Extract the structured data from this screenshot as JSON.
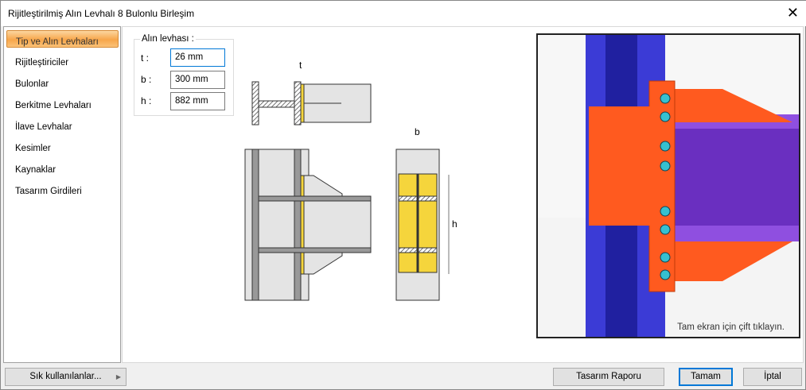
{
  "window": {
    "title": "Rijitleştirilmiş Alın Levhalı 8 Bulonlu Birleşim",
    "close_icon": "close-icon"
  },
  "sidebar": {
    "items": [
      {
        "label": "Tip ve Alın Levhaları",
        "active": true
      },
      {
        "label": "Rijitleştiriciler"
      },
      {
        "label": "Bulonlar"
      },
      {
        "label": "Berkitme Levhaları"
      },
      {
        "label": "İlave Levhalar"
      },
      {
        "label": "Kesimler"
      },
      {
        "label": "Kaynaklar"
      },
      {
        "label": "Tasarım Girdileri"
      }
    ]
  },
  "end_plate": {
    "title": "Alın levhası :",
    "fields": [
      {
        "label": "t :",
        "value": "26 mm"
      },
      {
        "label": "b :",
        "value": "300 mm"
      },
      {
        "label": "h :",
        "value": "882 mm"
      }
    ]
  },
  "drawing": {
    "t": "t",
    "b": "b",
    "h": "h"
  },
  "view3d": {
    "hint": "Tam ekran için çift tıklayın."
  },
  "footer": {
    "favorites": "Sık kullanılanlar...",
    "report": "Tasarım Raporu",
    "ok": "Tamam",
    "cancel": "İptal"
  },
  "colors": {
    "accent": "#f7a64a",
    "plate": "#ff5a1f",
    "beam": "#6a2fc0",
    "column": "#3a3ad0"
  }
}
